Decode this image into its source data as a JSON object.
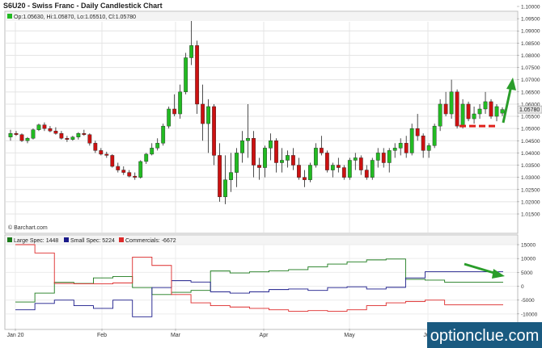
{
  "chart_data": [
    {
      "type": "candlestick",
      "title": "S6U20 - Swiss Franc - Daily Candlestick Chart",
      "ohlc_label": "Op:1.05630, Hi:1.05870, Lo:1.05510, Cl:1.05780",
      "last_price_label": "1.05780",
      "source_label": "© Barchart.com",
      "ylim": [
        1.015,
        1.1
      ],
      "y_ticks": [
        "1.01500",
        "1.02000",
        "1.02500",
        "1.03000",
        "1.03500",
        "1.04000",
        "1.04500",
        "1.05000",
        "1.05500",
        "1.06000",
        "1.06500",
        "1.07000",
        "1.07500",
        "1.08000",
        "1.08500",
        "1.09000",
        "1.09500",
        "1.10000"
      ],
      "grid": true,
      "colors": {
        "up": "#22bb22",
        "down": "#cc1111",
        "doji": "#111111",
        "annotation_arrow": "#2a9d2a",
        "annotation_line": "#e0201a"
      },
      "candles": [
        [
          1.0465,
          1.0495,
          1.045,
          1.048
        ],
        [
          1.048,
          1.049,
          1.047,
          1.0475
        ],
        [
          1.0475,
          1.048,
          1.0445,
          1.045
        ],
        [
          1.045,
          1.0465,
          1.044,
          1.046
        ],
        [
          1.046,
          1.05,
          1.0455,
          1.0495
        ],
        [
          1.0495,
          1.052,
          1.049,
          1.0515
        ],
        [
          1.0515,
          1.0525,
          1.049,
          1.05
        ],
        [
          1.05,
          1.051,
          1.0485,
          1.049
        ],
        [
          1.049,
          1.0505,
          1.0475,
          1.048
        ],
        [
          1.048,
          1.049,
          1.0455,
          1.046
        ],
        [
          1.046,
          1.047,
          1.0445,
          1.0455
        ],
        [
          1.0455,
          1.047,
          1.045,
          1.0465
        ],
        [
          1.0465,
          1.0485,
          1.0455,
          1.048
        ],
        [
          1.048,
          1.0495,
          1.047,
          1.0475
        ],
        [
          1.0475,
          1.048,
          1.043,
          1.044
        ],
        [
          1.044,
          1.045,
          1.04,
          1.041
        ],
        [
          1.041,
          1.042,
          1.039,
          1.0395
        ],
        [
          1.0395,
          1.0405,
          1.038,
          1.039
        ],
        [
          1.039,
          1.0395,
          1.034,
          1.0345
        ],
        [
          1.0345,
          1.036,
          1.032,
          1.033
        ],
        [
          1.033,
          1.0345,
          1.031,
          1.032
        ],
        [
          1.032,
          1.033,
          1.03,
          1.0305
        ],
        [
          1.0305,
          1.032,
          1.029,
          1.03
        ],
        [
          1.03,
          1.037,
          1.0295,
          1.0365
        ],
        [
          1.0365,
          1.04,
          1.0355,
          1.0395
        ],
        [
          1.0395,
          1.044,
          1.039,
          1.042
        ],
        [
          1.042,
          1.046,
          1.041,
          1.044
        ],
        [
          1.044,
          1.052,
          1.043,
          1.051
        ],
        [
          1.051,
          1.059,
          1.05,
          1.058
        ],
        [
          1.058,
          1.064,
          1.055,
          1.056
        ],
        [
          1.056,
          1.068,
          1.054,
          1.065
        ],
        [
          1.065,
          1.081,
          1.064,
          1.079
        ],
        [
          1.079,
          1.096,
          1.076,
          1.084
        ],
        [
          1.084,
          1.086,
          1.056,
          1.06
        ],
        [
          1.06,
          1.068,
          1.045,
          1.052
        ],
        [
          1.052,
          1.062,
          1.04,
          1.059
        ],
        [
          1.059,
          1.06,
          1.035,
          1.039
        ],
        [
          1.039,
          1.044,
          1.02,
          1.022
        ],
        [
          1.022,
          1.039,
          1.019,
          1.029
        ],
        [
          1.029,
          1.04,
          1.024,
          1.032
        ],
        [
          1.032,
          1.042,
          1.026,
          1.04
        ],
        [
          1.04,
          1.049,
          1.036,
          1.045
        ],
        [
          1.045,
          1.06,
          1.038,
          1.046
        ],
        [
          1.046,
          1.049,
          1.03,
          1.035
        ],
        [
          1.035,
          1.038,
          1.029,
          1.034
        ],
        [
          1.034,
          1.043,
          1.03,
          1.042
        ],
        [
          1.042,
          1.048,
          1.037,
          1.045
        ],
        [
          1.045,
          1.046,
          1.032,
          1.036
        ],
        [
          1.036,
          1.042,
          1.032,
          1.037
        ],
        [
          1.037,
          1.041,
          1.034,
          1.039
        ],
        [
          1.039,
          1.042,
          1.033,
          1.035
        ],
        [
          1.035,
          1.038,
          1.029,
          1.03
        ],
        [
          1.03,
          1.033,
          1.026,
          1.029
        ],
        [
          1.029,
          1.036,
          1.028,
          1.035
        ],
        [
          1.035,
          1.044,
          1.034,
          1.042
        ],
        [
          1.042,
          1.047,
          1.039,
          1.04
        ],
        [
          1.04,
          1.041,
          1.032,
          1.033
        ],
        [
          1.033,
          1.036,
          1.03,
          1.035
        ],
        [
          1.035,
          1.038,
          1.032,
          1.034
        ],
        [
          1.034,
          1.035,
          1.029,
          1.03
        ],
        [
          1.03,
          1.038,
          1.029,
          1.037
        ],
        [
          1.037,
          1.04,
          1.033,
          1.038
        ],
        [
          1.038,
          1.039,
          1.031,
          1.033
        ],
        [
          1.033,
          1.035,
          1.029,
          1.03
        ],
        [
          1.03,
          1.038,
          1.029,
          1.037
        ],
        [
          1.037,
          1.042,
          1.034,
          1.04
        ],
        [
          1.04,
          1.042,
          1.034,
          1.036
        ],
        [
          1.036,
          1.042,
          1.032,
          1.041
        ],
        [
          1.041,
          1.044,
          1.038,
          1.042
        ],
        [
          1.042,
          1.046,
          1.039,
          1.044
        ],
        [
          1.044,
          1.047,
          1.038,
          1.04
        ],
        [
          1.04,
          1.052,
          1.039,
          1.05
        ],
        [
          1.05,
          1.056,
          1.045,
          1.047
        ],
        [
          1.047,
          1.048,
          1.038,
          1.041
        ],
        [
          1.041,
          1.044,
          1.038,
          1.043
        ],
        [
          1.043,
          1.052,
          1.042,
          1.051
        ],
        [
          1.051,
          1.062,
          1.049,
          1.06
        ],
        [
          1.06,
          1.065,
          1.055,
          1.056
        ],
        [
          1.056,
          1.07,
          1.054,
          1.065
        ],
        [
          1.065,
          1.066,
          1.05,
          1.051
        ],
        [
          1.051,
          1.062,
          1.05,
          1.06
        ],
        [
          1.06,
          1.061,
          1.053,
          1.054
        ],
        [
          1.054,
          1.059,
          1.052,
          1.056
        ],
        [
          1.056,
          1.06,
          1.054,
          1.058
        ],
        [
          1.058,
          1.065,
          1.056,
          1.061
        ],
        [
          1.061,
          1.062,
          1.054,
          1.055
        ],
        [
          1.055,
          1.06,
          1.053,
          1.059
        ],
        [
          1.0563,
          1.0587,
          1.0551,
          1.0578
        ]
      ],
      "x_labels": [
        "Jan 20",
        "Feb",
        "Mar",
        "Apr",
        "May",
        "Jun"
      ],
      "annotations": {
        "arrow_direction": "up",
        "dashed_level": 1.051
      }
    },
    {
      "type": "line",
      "legend": [
        {
          "label": "Large Spec: 1448",
          "color": "#1a7a1a"
        },
        {
          "label": "Small Spec: 5224",
          "color": "#1a1a8a"
        },
        {
          "label": "Commercials: -6672",
          "color": "#dd2a2a"
        }
      ],
      "ylim": [
        -15000,
        15000
      ],
      "y_ticks": [
        "15000",
        "10000",
        "5000",
        "0",
        "-5000",
        "-10000"
      ],
      "x": [
        0,
        1,
        2,
        3,
        4,
        5,
        6,
        7,
        8,
        9,
        10,
        11,
        12,
        13,
        14,
        15,
        16,
        17,
        18,
        19,
        20,
        21,
        22,
        23,
        24,
        25
      ],
      "series": [
        {
          "name": "Large Spec",
          "color": "#1a7a1a",
          "values": [
            -5700,
            -2500,
            1400,
            1000,
            3000,
            3500,
            -500,
            -3000,
            -2200,
            -1500,
            5500,
            4800,
            5200,
            5600,
            6000,
            7000,
            8000,
            8800,
            9500,
            9800,
            2500,
            2200,
            1448,
            1448,
            1448,
            1448
          ]
        },
        {
          "name": "Small Spec",
          "color": "#1a1a8a",
          "values": [
            -8500,
            -6200,
            -5000,
            -7000,
            -8000,
            -5000,
            -11000,
            -500,
            2000,
            1500,
            -2000,
            -2500,
            -2000,
            -1200,
            -1000,
            -1500,
            -500,
            -200,
            -1000,
            -400,
            3000,
            5224,
            5224,
            5224,
            5224,
            5224
          ]
        },
        {
          "name": "Commercials",
          "color": "#dd2a2a",
          "values": [
            15000,
            12000,
            1000,
            900,
            900,
            1200,
            10500,
            7500,
            -3000,
            -6000,
            -7000,
            -7500,
            -8000,
            -8500,
            -9000,
            -8800,
            -9000,
            -8500,
            -7000,
            -6000,
            -5500,
            -5000,
            -6672,
            -6672,
            -6672,
            -6672
          ]
        }
      ],
      "annotations": {
        "arrow_direction": "down"
      }
    }
  ],
  "watermark": "optionclue.com"
}
